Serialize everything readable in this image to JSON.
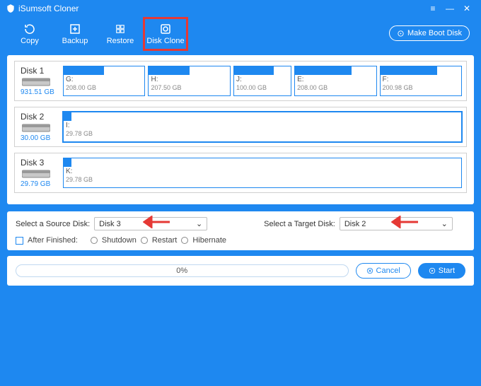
{
  "app": {
    "title": "iSumsoft Cloner"
  },
  "window_controls": {
    "menu": "≡",
    "min": "—",
    "close": "✕"
  },
  "tools": [
    {
      "label": "Copy"
    },
    {
      "label": "Backup"
    },
    {
      "label": "Restore"
    },
    {
      "label": "Disk Clone",
      "active": true
    }
  ],
  "boot_button": "Make Boot Disk",
  "disks": [
    {
      "name": "Disk 1",
      "size": "931.51 GB",
      "partitions": [
        {
          "letter": "G:",
          "size": "208.00 GB",
          "fill": 0.5,
          "grow": 1
        },
        {
          "letter": "H:",
          "size": "207.50 GB",
          "fill": 0.5,
          "grow": 1
        },
        {
          "letter": "J:",
          "size": "100.00 GB",
          "fill": 0.7,
          "grow": 0.7
        },
        {
          "letter": "E:",
          "size": "208.00 GB",
          "fill": 0.7,
          "grow": 1
        },
        {
          "letter": "F:",
          "size": "200.98 GB",
          "fill": 0.7,
          "grow": 1
        }
      ]
    },
    {
      "name": "Disk 2",
      "size": "30.00 GB",
      "partitions": [
        {
          "letter": "I:",
          "size": "29.78 GB",
          "fill": 0.02,
          "grow": 1,
          "selected": true
        }
      ]
    },
    {
      "name": "Disk 3",
      "size": "29.79 GB",
      "partitions": [
        {
          "letter": "K:",
          "size": "29.78 GB",
          "fill": 0.02,
          "grow": 1
        }
      ]
    }
  ],
  "select": {
    "source_label": "Select a Source Disk:",
    "source_value": "Disk 3",
    "target_label": "Select a Target Disk:",
    "target_value": "Disk 2"
  },
  "after": {
    "label": "After Finished:",
    "options": [
      "Shutdown",
      "Restart",
      "Hibernate"
    ]
  },
  "progress": {
    "text": "0%"
  },
  "buttons": {
    "cancel": "Cancel",
    "start": "Start"
  }
}
